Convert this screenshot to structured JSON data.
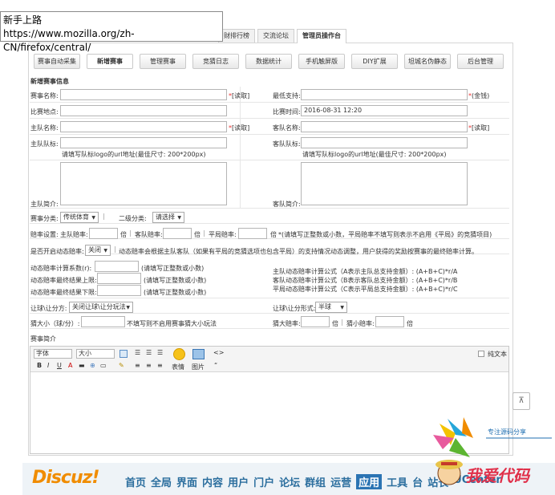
{
  "tooltip": {
    "title": "新手上路",
    "url": "https://www.mozilla.org/zh-CN/firefox/central/"
  },
  "top_tabs": [
    {
      "label": "财排行榜"
    },
    {
      "label": "交流论坛"
    },
    {
      "label": "管理员操作台"
    }
  ],
  "subnav": [
    "赛事自动采集",
    "新增赛事",
    "管理赛事",
    "竞猜日志",
    "数据统计",
    "手机触屏版",
    "DIY扩展",
    "坦城名伪静态",
    "后台管理"
  ],
  "section_title": "新增赛事信息",
  "form": {
    "match_name": "赛事名称:",
    "read": "[读取]",
    "min_bet": "最低支持:",
    "coin": "(金钱)",
    "venue": "比赛地点:",
    "time_label": "比赛时间:",
    "time_value": "2016-08-31 12:20",
    "home_name": "主队名称:",
    "away_name": "客队名称:",
    "home_logo": "主队队标:",
    "away_logo": "客队队标:",
    "logo_hint": "请填写队标logo的url地址(最佳尺寸: 200*200px)",
    "home_intro": "主队简介:",
    "away_intro": "客队简介:",
    "cat_label": "赛事分类:",
    "cat_value": "传统体育",
    "subcat_label": "二级分类:",
    "subcat_value": "请选择",
    "odds_label": "赔率设置:",
    "home_odds": "主队赔率:",
    "times": "倍",
    "away_odds": "客队赔率:",
    "draw_odds": "平局赔率:",
    "odds_hint": "*(请填写正整数或小数，平局赔率不填写则表示不启用《平局》的竞猜项目)",
    "dyn_label": "是否开启动态赔率:",
    "dyn_value": "关闭",
    "dyn_hint": "动态赔率会根据主队客队（如果有平局的竞猜选项也包含平局）的支持情况动态调整，用户获得的奖励按赛事的最终赔率计算。",
    "dyn_coef": "动态赔率计算系数(r):",
    "dyn_max": "动态赔率最终结果上限:",
    "dyn_min": "动态赔率最终结果下限:",
    "int_hint": "(请填写正整数或小数)",
    "formula_home": "主队动态赔率计算公式（A表示主队总支持金额）: (A+B+C)*r/A",
    "formula_away": "客队动态赔率计算公式（B表示客队总支持金额）: (A+B+C)*r/B",
    "formula_draw": "平局动态赔率计算公式（C表示平局总支持金额）: (A+B+C)*r/C",
    "hcp_side": "让球\\让分方:",
    "hcp_side_value": "关闭让球\\让分玩法",
    "hcp_form": "让球\\让分形式:",
    "hcp_form_value": "半球",
    "bs_label": "猜大小（球/分）:",
    "bs_hint": "不填写则不启用赛事猜大小玩法",
    "big_odds": "猜大赔率:",
    "small_odds": "猜小赔率:",
    "intro_label": "赛事简介"
  },
  "editor": {
    "font_label": "字体",
    "size_label": "大小",
    "emoji_label": "表情",
    "image_label": "图片",
    "plain_text": "纯文本"
  },
  "discuz": {
    "logo": "Discuz!",
    "nav": [
      "首页",
      "全局",
      "界面",
      "内容",
      "用户",
      "门户",
      "论坛",
      "群组",
      "运营",
      "应用",
      "工具"
    ],
    "active": "应用",
    "trail": [
      "台",
      "站长",
      "UCenter"
    ]
  },
  "watermark": {
    "line1": "专注源码分享",
    "line2": "我爱代码"
  },
  "colors": {
    "accent": "#2b74b3",
    "required": "#e33333",
    "logo": "#f08c00"
  }
}
